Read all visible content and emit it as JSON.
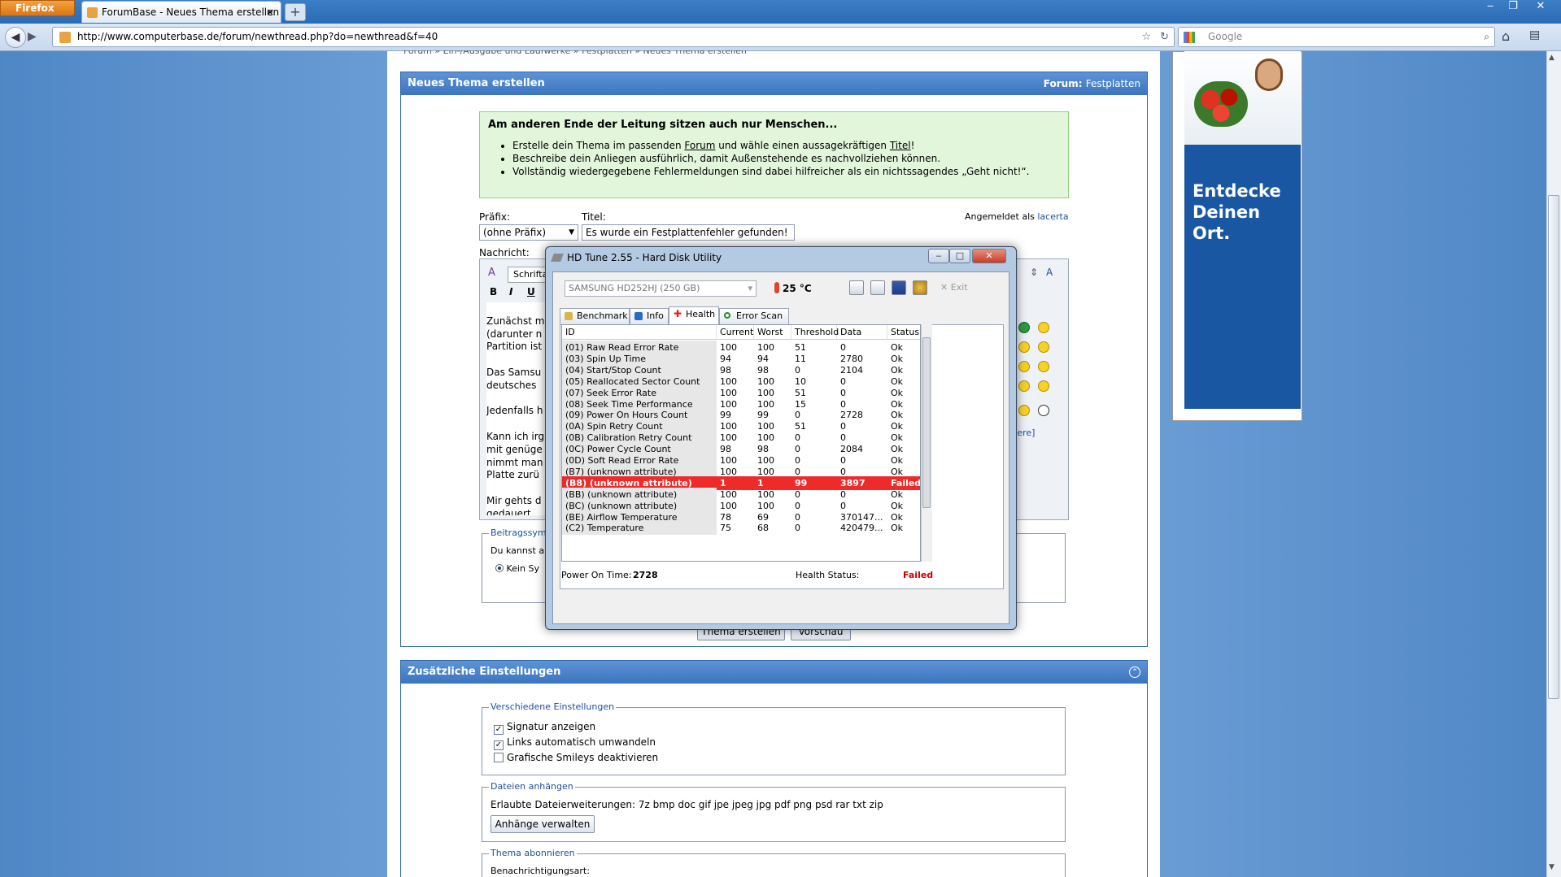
{
  "browser": {
    "firefox_label": "Firefox",
    "tab_title": "ForumBase - Neues Thema erstellen",
    "tab_close": "×",
    "new_tab": "+",
    "url": "http://www.computerbase.de/forum/newthread.php?do=newthread&f=40",
    "search_placeholder": "Google"
  },
  "page": {
    "breadcrumb_hint": "Forum » Ein-/Ausgabe und Laufwerke » Festplatten » Neues Thema erstellen",
    "panel_title": "Neues Thema erstellen",
    "forum_label": "Forum:",
    "forum_name": "Festplatten",
    "tip_title": "Am anderen Ende der Leitung sitzen auch nur Menschen...",
    "tip_items": [
      {
        "pre": "Erstelle dein Thema im passenden ",
        "link1": "Forum",
        "mid": " und wähle einen aussagekräftigen ",
        "link2": "Titel",
        "post": "!"
      },
      {
        "text": "Beschreibe dein Anliegen ausführlich, damit Außenstehende es nachvollziehen können."
      },
      {
        "text": "Vollständig wiedergegebene Fehlermeldungen sind dabei hilfreicher als ein nichtssagendes „Geht nicht!“."
      }
    ],
    "prefix_label": "Präfix:",
    "prefix_value": "(ohne Präfix)",
    "title_label": "Titel:",
    "title_value": "Es wurde ein Festplattenfehler gefunden!",
    "logged_in_label": "Angemeldet als",
    "logged_in_user": "lacerta",
    "message_label": "Nachricht:",
    "font_label": "Schrifta",
    "editor_lines": [
      "Zunächst m",
      "(darunter n",
      "Partition ist",
      "",
      "Das Samsu",
      "deutsches",
      "",
      "Jedenfalls h",
      "",
      "Kann ich irg",
      "mit genüge",
      "nimmt man",
      "Platte zurü",
      "",
      "Mir gehts d",
      "gedauert."
    ],
    "more_smileys": "tere]",
    "post_icons_legend": "Beitragssymb",
    "post_icons_text": "Du kannst a",
    "no_icon": "Kein Sy",
    "submit_button": "Thema erstellen",
    "preview_button": "Vorschau",
    "extra_panel_title": "Zusätzliche Einstellungen",
    "misc_legend": "Verschiedene Einstellungen",
    "options": [
      {
        "label": "Signatur anzeigen",
        "checked": "✓"
      },
      {
        "label": "Links automatisch umwandeln",
        "checked": "✓"
      },
      {
        "label": "Grafische Smileys deaktivieren",
        "checked": ""
      }
    ],
    "attach_legend": "Dateien anhängen",
    "attach_text": "Erlaubte Dateierweiterungen: 7z bmp doc gif jpe jpeg jpg pdf png psd rar txt zip",
    "attach_button": "Anhänge verwalten",
    "subscribe_legend": "Thema abonnieren",
    "notify_label": "Benachrichtigungsart:"
  },
  "ad": {
    "text_line1": "Entdecke",
    "text_line2": "Deinen Ort."
  },
  "hdtune": {
    "title": "HD Tune 2.55 - Hard Disk Utility",
    "drive": "SAMSUNG HD252HJ (250 GB)",
    "temperature": "25 °C",
    "exit": "Exit",
    "tabs": [
      "Benchmark",
      "Info",
      "Health",
      "Error Scan"
    ],
    "columns": [
      "ID",
      "Current",
      "Worst",
      "Threshold",
      "Data",
      "Status"
    ],
    "rows": [
      [
        "(01) Raw Read Error Rate",
        "100",
        "100",
        "51",
        "0",
        "Ok"
      ],
      [
        "(03) Spin Up Time",
        "94",
        "94",
        "11",
        "2780",
        "Ok"
      ],
      [
        "(04) Start/Stop Count",
        "98",
        "98",
        "0",
        "2104",
        "Ok"
      ],
      [
        "(05) Reallocated Sector Count",
        "100",
        "100",
        "10",
        "0",
        "Ok"
      ],
      [
        "(07) Seek Error Rate",
        "100",
        "100",
        "51",
        "0",
        "Ok"
      ],
      [
        "(08) Seek Time Performance",
        "100",
        "100",
        "15",
        "0",
        "Ok"
      ],
      [
        "(09) Power On Hours Count",
        "99",
        "99",
        "0",
        "2728",
        "Ok"
      ],
      [
        "(0A) Spin Retry Count",
        "100",
        "100",
        "51",
        "0",
        "Ok"
      ],
      [
        "(0B) Calibration Retry Count",
        "100",
        "100",
        "0",
        "0",
        "Ok"
      ],
      [
        "(0C) Power Cycle Count",
        "98",
        "98",
        "0",
        "2084",
        "Ok"
      ],
      [
        "(0D) Soft Read Error Rate",
        "100",
        "100",
        "0",
        "0",
        "Ok"
      ],
      [
        "(B7) (unknown attribute)",
        "100",
        "100",
        "0",
        "0",
        "Ok"
      ],
      [
        "(B8) (unknown attribute)",
        "1",
        "1",
        "99",
        "3897",
        "Failed"
      ],
      [
        "(BB) (unknown attribute)",
        "100",
        "100",
        "0",
        "0",
        "Ok"
      ],
      [
        "(BC) (unknown attribute)",
        "100",
        "100",
        "0",
        "0",
        "Ok"
      ],
      [
        "(BE) Airflow Temperature",
        "78",
        "69",
        "0",
        "370147...",
        "Ok"
      ],
      [
        "(C2) Temperature",
        "75",
        "68",
        "0",
        "420479...",
        "Ok"
      ]
    ],
    "power_on_label": "Power On Time:",
    "power_on_value": "2728",
    "health_label": "Health Status:",
    "health_value": "Failed",
    "failed_color": "#ee2a2a"
  }
}
